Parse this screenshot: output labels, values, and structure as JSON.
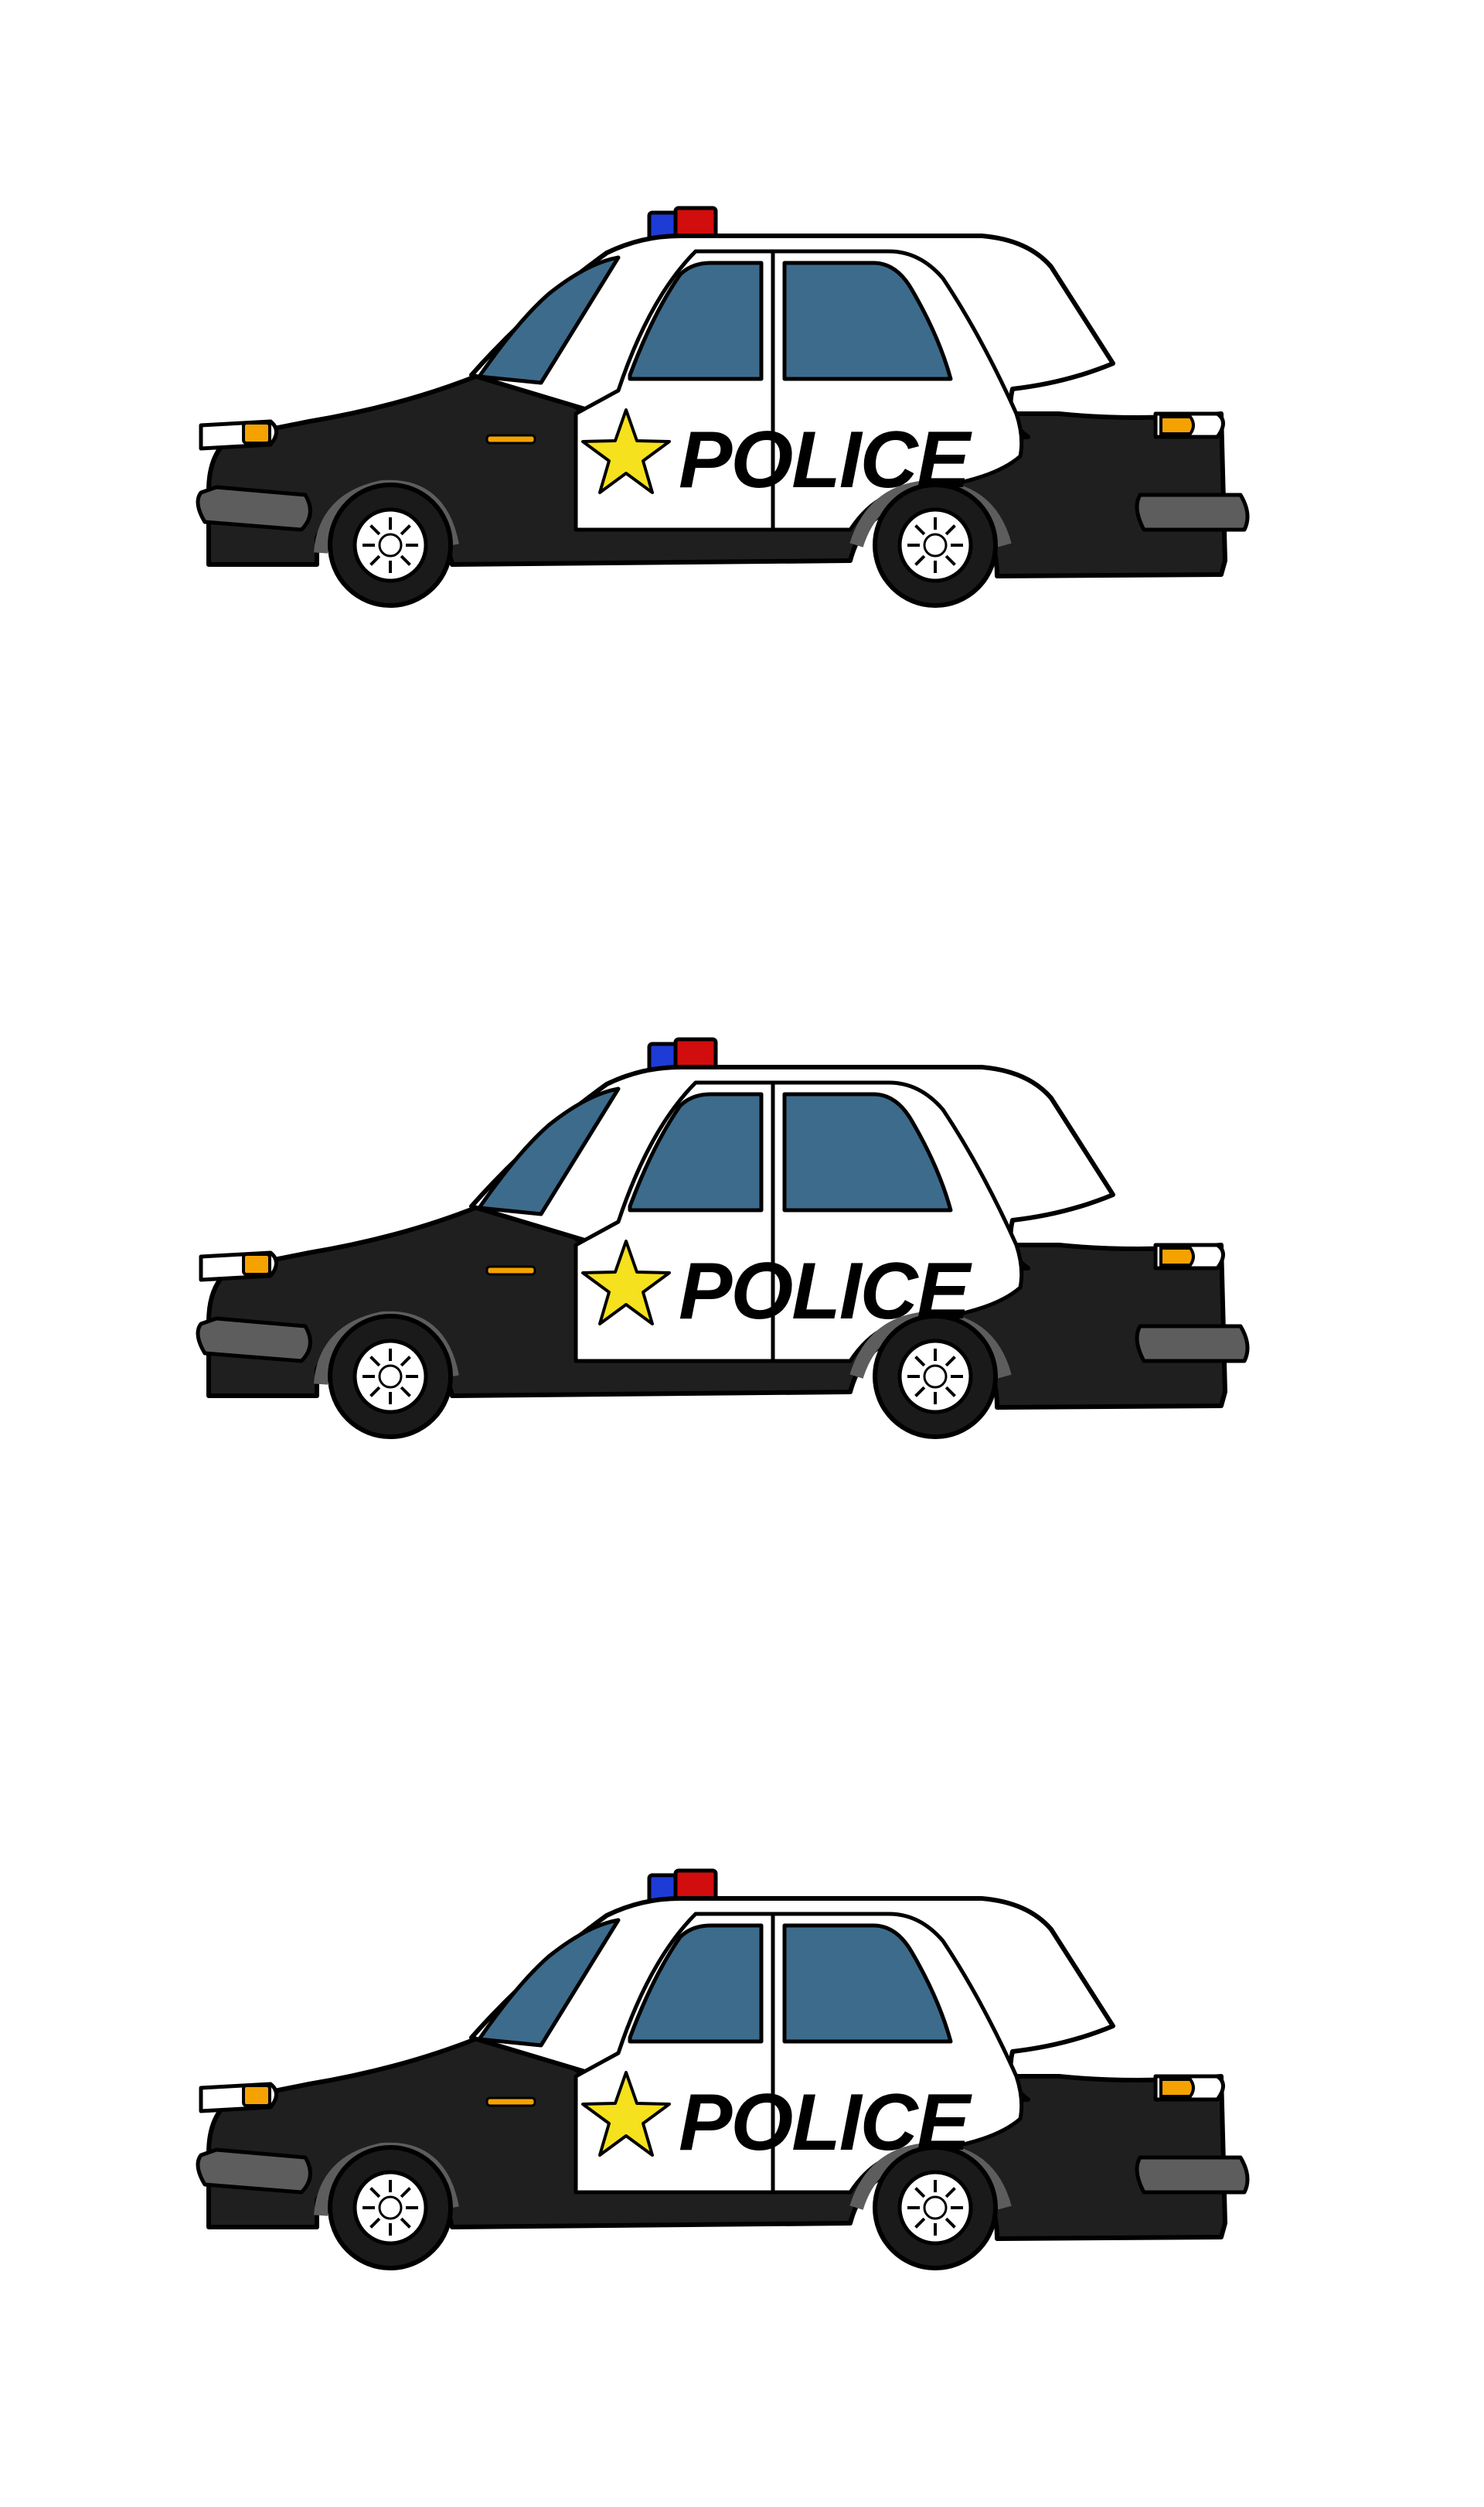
{
  "cars": [
    {
      "id": "car-1",
      "label": "POLICE"
    },
    {
      "id": "car-2",
      "label": "POLICE"
    },
    {
      "id": "car-3",
      "label": "POLICE"
    }
  ],
  "colors": {
    "background": "#ffffff",
    "body_black": "#1f1f1f",
    "body_white": "#ffffff",
    "window": "#3d6b8c",
    "bumper": "#5d5d5d",
    "light_blue": "#1f3bd6",
    "light_red": "#d10d0d",
    "star": "#f6e11e",
    "indicator": "#f5a201",
    "outline": "#000000"
  },
  "icons": [
    "police-car",
    "siren-light-icon",
    "star-badge-icon",
    "wheel-icon",
    "headlight-icon",
    "taillight-icon"
  ]
}
